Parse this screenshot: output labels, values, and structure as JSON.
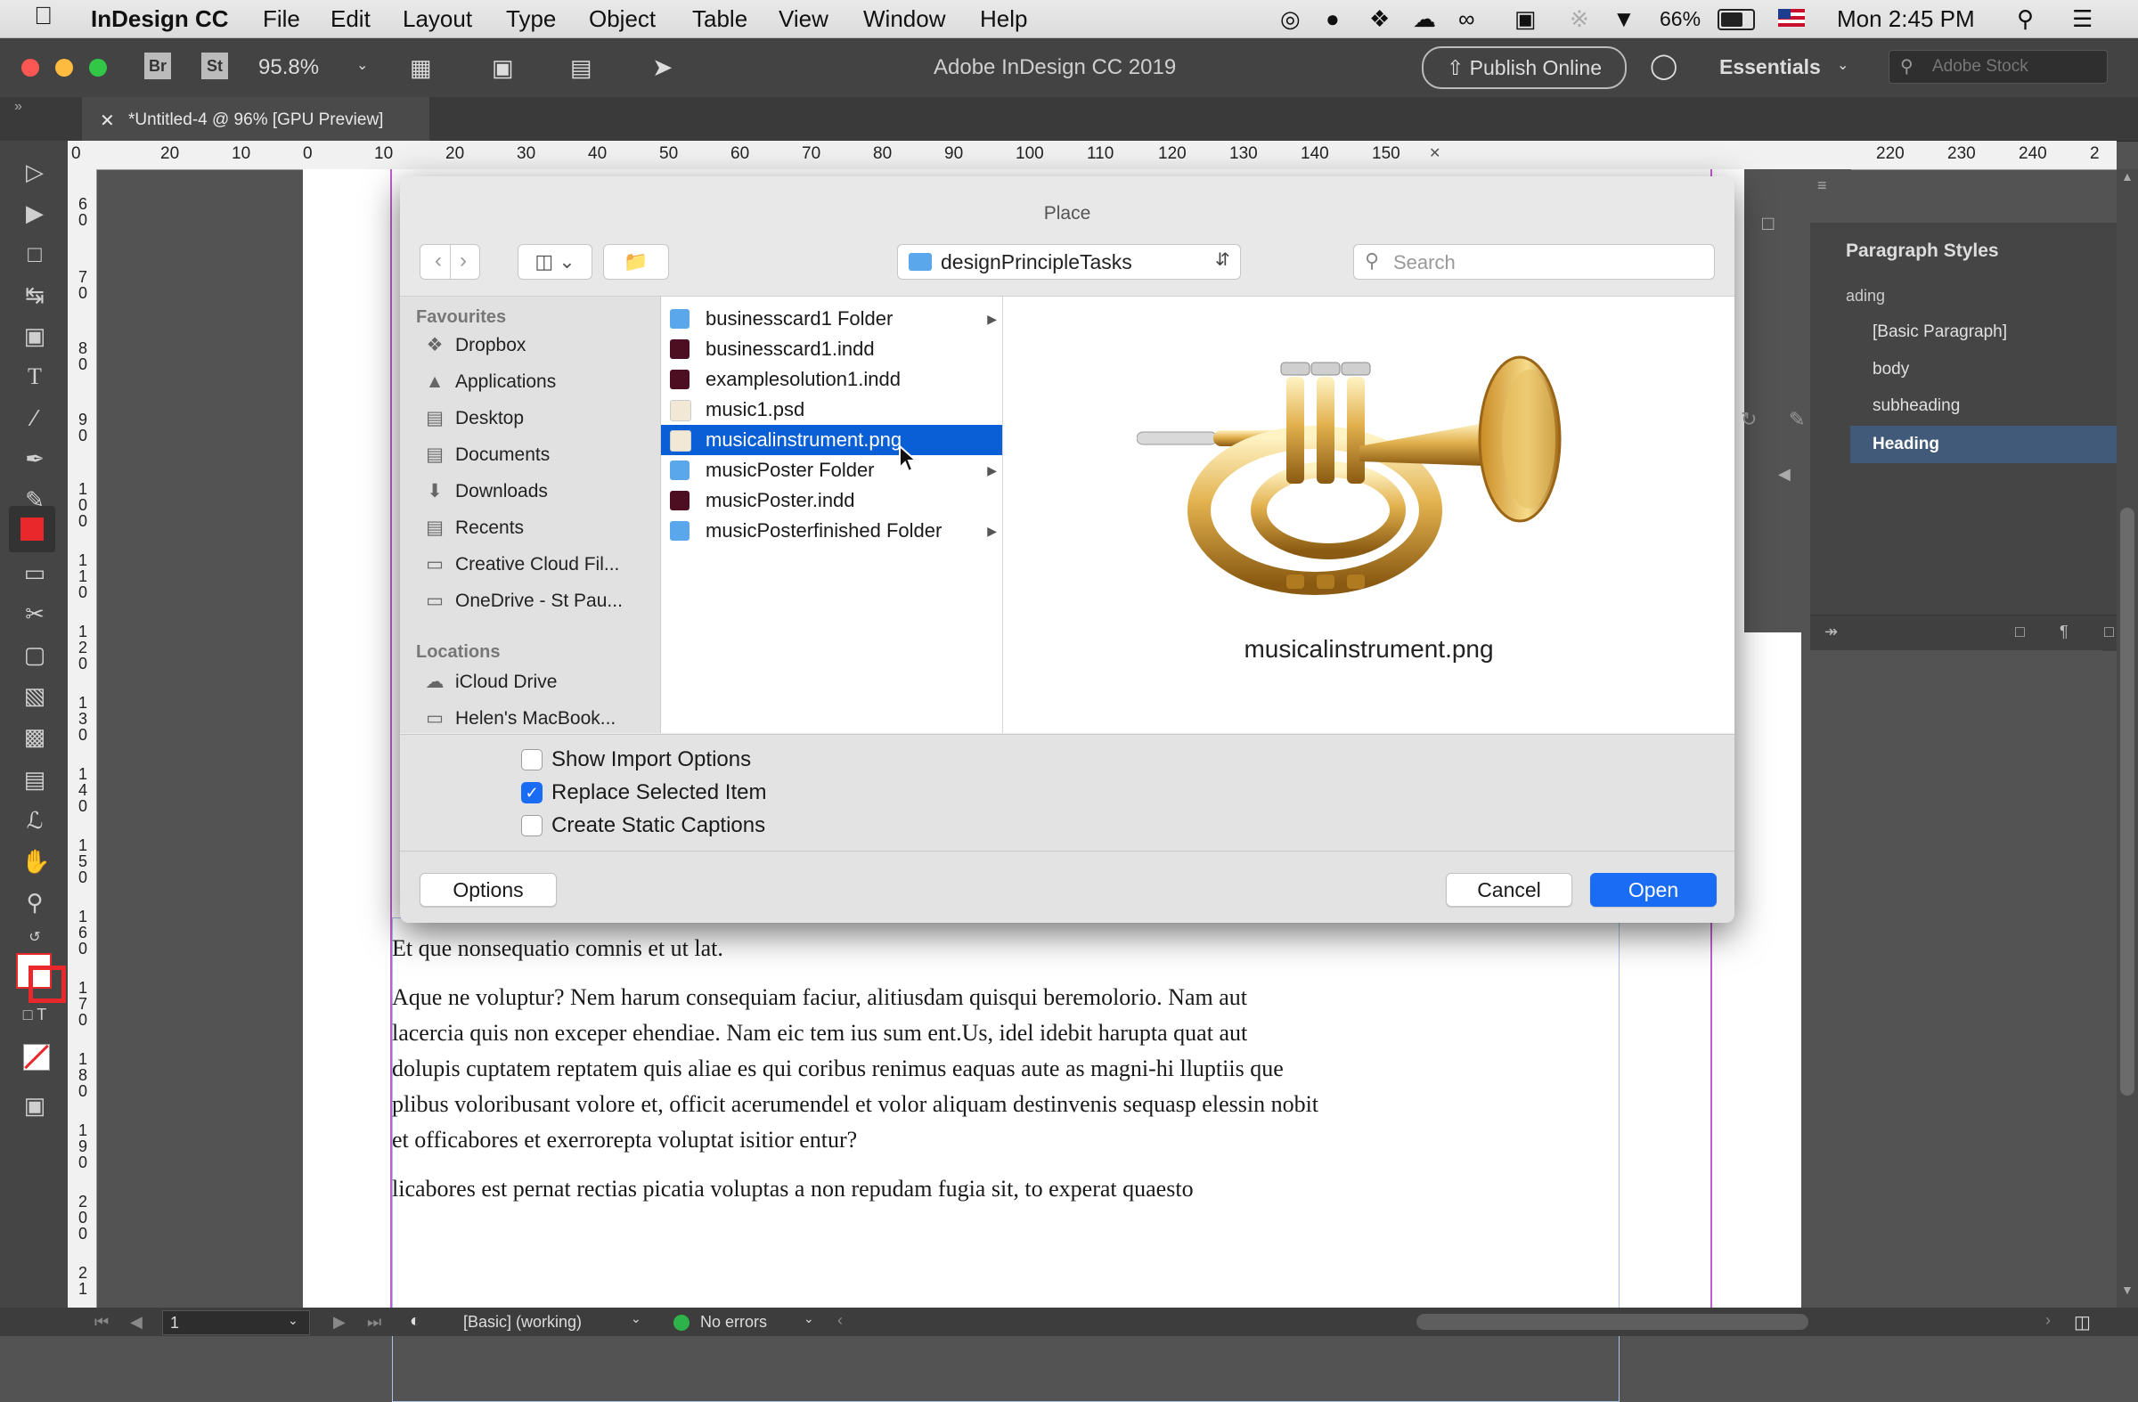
{
  "menubar": {
    "apple_icon": "apple-icon",
    "app_name": "InDesign CC",
    "items": [
      "File",
      "Edit",
      "Layout",
      "Type",
      "Object",
      "Table",
      "View",
      "Window",
      "Help"
    ],
    "battery": "66%",
    "clock": "Mon 2:45 PM"
  },
  "appbar": {
    "br": "Br",
    "st": "St",
    "zoom": "95.8%",
    "title": "Adobe InDesign CC 2019",
    "publish": "Publish Online",
    "workspace": "Essentials",
    "stock_placeholder": "Adobe Stock"
  },
  "doctab": {
    "title": "*Untitled-4 @ 96% [GPU Preview]"
  },
  "hruler": [
    "0",
    "20",
    "10",
    "0",
    "10",
    "20",
    "30",
    "40",
    "50",
    "60",
    "70",
    "80",
    "90",
    "100",
    "110",
    "120",
    "130",
    "140",
    "150",
    "220",
    "230",
    "240",
    "2"
  ],
  "vruler": [
    "6 0",
    "7 0",
    "8 0",
    "9 0",
    "1 0 0",
    "1 1 0",
    "1 2 0",
    "1 3 0",
    "1 4 0",
    "1 5 0",
    "1 6 0",
    "1 7 0",
    "1 8 0",
    "1 9 0",
    "2 0 0",
    "2 1"
  ],
  "page": {
    "para1": "Et que nonsequatio comnis et ut lat.",
    "para2": "Aque ne voluptur? Nem harum consequiam faciur, alitiusdam quisqui beremolorio. Nam aut lacercia quis non exceper ehendiae. Nam eic tem ius sum ent.Us, idel idebit harupta quat aut dolupis cuptatem reptatem quis aliae es qui coribus renimus eaquas aute as magni-hi lluptiis que plibus voloribusant volore et, officit acerumendel et volor aliquam destinvenis sequasp elessin nobit et officabores et exerrorepta voluptat isitior entur?",
    "para3": "licabores est pernat rectias picatia voluptas a non repudam fugia sit, to experat quaesto"
  },
  "paragraph_styles": {
    "title": "Paragraph Styles",
    "current": "ading",
    "items": [
      "[Basic Paragraph]",
      "body",
      "subheading",
      "Heading"
    ],
    "selected": "Heading"
  },
  "dialog": {
    "title": "Place",
    "folder": "designPrincipleTasks",
    "search_placeholder": "Search",
    "favourites_header": "Favourites",
    "favourites": [
      {
        "label": "Dropbox",
        "icon": "dropbox-icon"
      },
      {
        "label": "Applications",
        "icon": "applications-icon"
      },
      {
        "label": "Desktop",
        "icon": "desktop-icon"
      },
      {
        "label": "Documents",
        "icon": "documents-icon"
      },
      {
        "label": "Downloads",
        "icon": "downloads-icon"
      },
      {
        "label": "Recents",
        "icon": "recents-icon"
      },
      {
        "label": "Creative Cloud Fil...",
        "icon": "folder-icon"
      },
      {
        "label": "OneDrive - St Pau...",
        "icon": "folder-icon"
      }
    ],
    "locations_header": "Locations",
    "locations": [
      {
        "label": "iCloud Drive",
        "icon": "cloud-icon"
      },
      {
        "label": "Helen's MacBook...",
        "icon": "laptop-icon"
      }
    ],
    "files": [
      {
        "name": "businesscard1 Folder",
        "type": "folder"
      },
      {
        "name": "businesscard1.indd",
        "type": "indd"
      },
      {
        "name": "examplesolution1.indd",
        "type": "indd"
      },
      {
        "name": "music1.psd",
        "type": "image"
      },
      {
        "name": "musicalinstrument.png",
        "type": "image"
      },
      {
        "name": "musicPoster Folder",
        "type": "folder"
      },
      {
        "name": "musicPoster.indd",
        "type": "indd"
      },
      {
        "name": "musicPosterfinished Folder",
        "type": "folder"
      }
    ],
    "selected_file": "musicalinstrument.png",
    "preview_name": "musicalinstrument.png",
    "options": {
      "show_import": "Show Import Options",
      "replace_selected": "Replace Selected Item",
      "create_captions": "Create Static Captions"
    },
    "buttons": {
      "options": "Options",
      "cancel": "Cancel",
      "open": "Open"
    }
  },
  "statusbar": {
    "page": "1",
    "profile": "[Basic] (working)",
    "errors": "No errors"
  },
  "colors": {
    "accent": "#1a6cf5",
    "selection": "#0a5fd6",
    "heading_row": "#415a7a"
  }
}
